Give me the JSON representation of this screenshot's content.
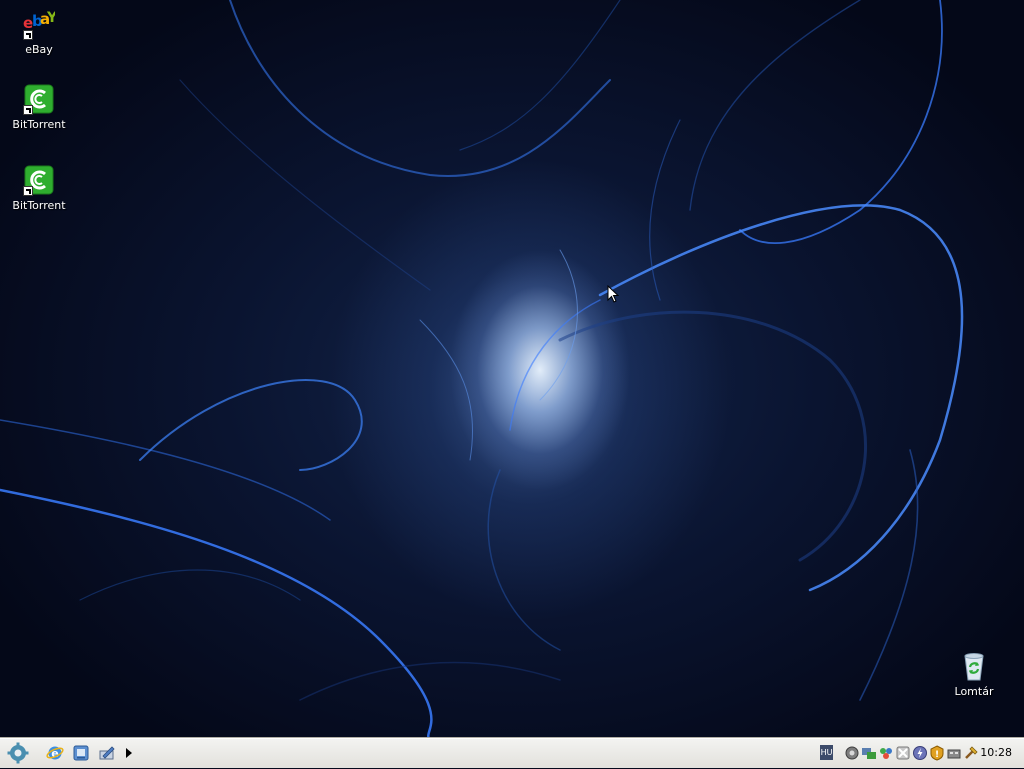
{
  "desktop": {
    "icons": [
      {
        "label": "eBay",
        "icon": "ebay-icon"
      },
      {
        "label": "BitTorrent",
        "icon": "bittorrent-icon"
      },
      {
        "label": "BitTorrent",
        "icon": "bittorrent-icon"
      },
      {
        "label": "Lomtár",
        "icon": "recycle-bin-icon"
      }
    ]
  },
  "taskbar": {
    "start_icon": "start-gear-icon",
    "quick_launch": [
      "internet-explorer-icon",
      "show-desktop-icon",
      "quick-launch-app-icon"
    ],
    "language_indicator": "HU",
    "tray_icons": [
      "speaker-icon",
      "network-icon",
      "messenger-icon",
      "network-disconnected-icon",
      "power-icon",
      "security-alert-icon",
      "safely-remove-hardware-icon",
      "tool-icon"
    ],
    "clock": "10:28"
  },
  "colors": {
    "wallpaper_base": "#050a1c",
    "wallpaper_glow": "#cfe0ff",
    "taskbar_bg": "#ebeae6",
    "bittorrent_green": "#2fae2f"
  }
}
